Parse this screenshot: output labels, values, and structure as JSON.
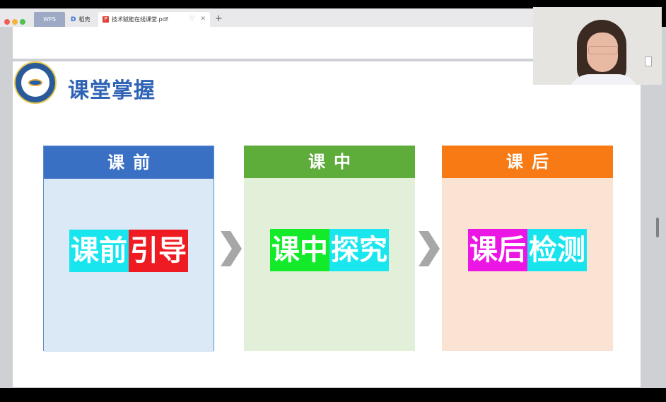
{
  "browser": {
    "tabs": [
      {
        "label": "WPS"
      },
      {
        "label": "稻壳",
        "icon": "D"
      },
      {
        "label": "技术赋能在线课堂.pdf",
        "icon": "P"
      }
    ],
    "new_tab": "+"
  },
  "slide": {
    "title": "课堂掌握",
    "columns": [
      {
        "header": "课前",
        "header_color": "#3a70c4",
        "body_color": "#dbe8f6",
        "segments": [
          {
            "text": "课前",
            "bg": "#18e6ee"
          },
          {
            "text": "引导",
            "bg": "#ee1c22"
          }
        ]
      },
      {
        "header": "课中",
        "header_color": "#5eac3a",
        "body_color": "#e2f0d9",
        "segments": [
          {
            "text": "课中",
            "bg": "#12ea2a"
          },
          {
            "text": "探究",
            "bg": "#1ae6ee"
          }
        ]
      },
      {
        "header": "课后",
        "header_color": "#f77a14",
        "body_color": "#fbe3d3",
        "segments": [
          {
            "text": "课后",
            "bg": "#ec16e4"
          },
          {
            "text": "检测",
            "bg": "#18e4ee"
          }
        ]
      }
    ]
  }
}
